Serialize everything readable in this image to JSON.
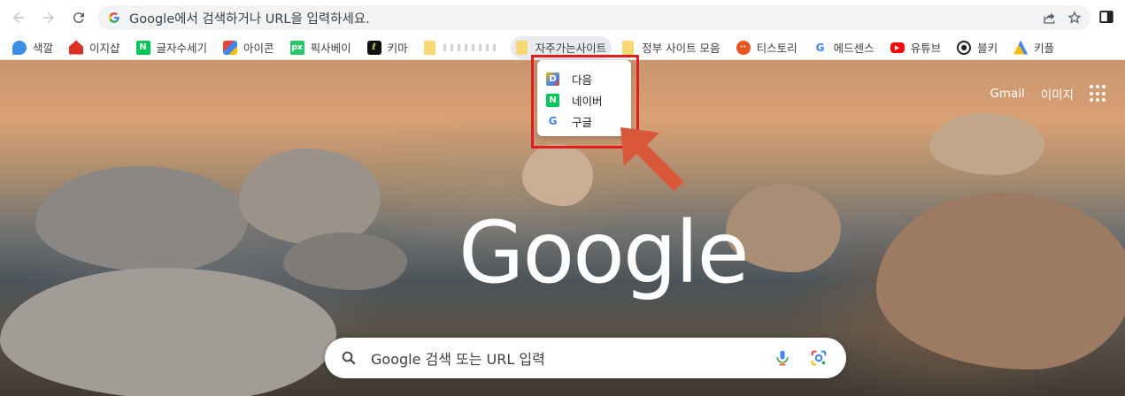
{
  "toolbar": {
    "address_text": "Google에서 검색하거나 URL을 입력하세요."
  },
  "bookmarks": [
    {
      "label": "색깔",
      "icon": "color-palette-icon",
      "color": "#3a8ee6"
    },
    {
      "label": "이지샵",
      "icon": "shop-house-icon",
      "color": "#d93025"
    },
    {
      "label": "글자수세기",
      "icon": "naver-n-icon",
      "color": "#03c75a"
    },
    {
      "label": "아이콘",
      "icon": "icon-shapes-icon",
      "color": "#4285f4"
    },
    {
      "label": "픽사베이",
      "icon": "pixabay-icon",
      "color": "#2ec66d"
    },
    {
      "label": "키마",
      "icon": "keyma-icon",
      "color": "#111111"
    },
    {
      "label": "",
      "icon": "folder-icon",
      "color": "#f8d775"
    },
    {
      "label": "자주가는사이트",
      "icon": "folder-icon",
      "color": "#f8d775"
    },
    {
      "label": "정부 사이트 모음",
      "icon": "folder-icon",
      "color": "#f8d775"
    },
    {
      "label": "티스토리",
      "icon": "tistory-icon",
      "color": "#eb531f"
    },
    {
      "label": "에드센스",
      "icon": "google-g-icon",
      "color": "#4285f4"
    },
    {
      "label": "유튜브",
      "icon": "youtube-icon",
      "color": "#ff0000"
    },
    {
      "label": "블키",
      "icon": "target-icon",
      "color": "#222222"
    },
    {
      "label": "키플",
      "icon": "google-ads-icon",
      "color": "#fbbc04"
    }
  ],
  "folder_menu": {
    "items": [
      {
        "label": "다음",
        "icon": "daum-icon"
      },
      {
        "label": "네이버",
        "icon": "naver-n-icon"
      },
      {
        "label": "구글",
        "icon": "google-g-icon"
      }
    ]
  },
  "top_links": {
    "gmail": "Gmail",
    "images": "이미지"
  },
  "logo_text": "Google",
  "search": {
    "placeholder": "Google 검색 또는 URL 입력"
  }
}
